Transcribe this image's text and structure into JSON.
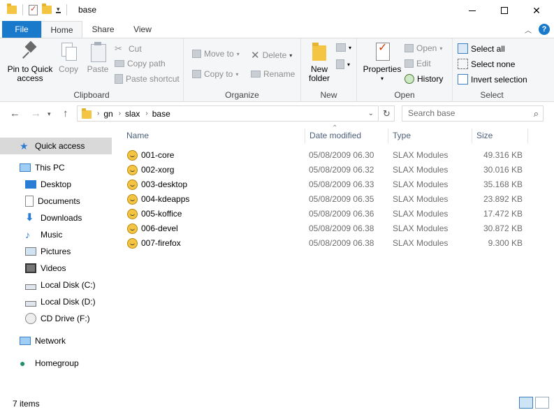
{
  "window": {
    "title": "base",
    "qat_dropdown": "▾"
  },
  "tabs": {
    "file": "File",
    "home": "Home",
    "share": "Share",
    "view": "View"
  },
  "ribbon": {
    "clipboard": {
      "label": "Clipboard",
      "pin_line1": "Pin to Quick",
      "pin_line2": "access",
      "copy": "Copy",
      "paste": "Paste",
      "cut": "Cut",
      "copy_path": "Copy path",
      "paste_shortcut": "Paste shortcut"
    },
    "organize": {
      "label": "Organize",
      "move_to": "Move to",
      "copy_to": "Copy to",
      "delete": "Delete",
      "rename": "Rename"
    },
    "new": {
      "label": "New",
      "new_folder_line1": "New",
      "new_folder_line2": "folder"
    },
    "open": {
      "label": "Open",
      "properties": "Properties",
      "open": "Open",
      "edit": "Edit",
      "history": "History"
    },
    "select": {
      "label": "Select",
      "select_all": "Select all",
      "select_none": "Select none",
      "invert_selection": "Invert selection"
    }
  },
  "address": {
    "crumbs": [
      "gn",
      "slax",
      "base"
    ],
    "search_placeholder": "Search base"
  },
  "nav": {
    "quick_access": "Quick access",
    "this_pc": "This PC",
    "desktop": "Desktop",
    "documents": "Documents",
    "downloads": "Downloads",
    "music": "Music",
    "pictures": "Pictures",
    "videos": "Videos",
    "local_c": "Local Disk (C:)",
    "local_d": "Local Disk (D:)",
    "cd_drive": "CD Drive (F:)",
    "network": "Network",
    "homegroup": "Homegroup"
  },
  "columns": {
    "name": "Name",
    "date": "Date modified",
    "type": "Type",
    "size": "Size"
  },
  "files": [
    {
      "name": "001-core",
      "date": "05/08/2009 06.30",
      "type": "SLAX Modules",
      "size": "49.316 KB"
    },
    {
      "name": "002-xorg",
      "date": "05/08/2009 06.32",
      "type": "SLAX Modules",
      "size": "30.016 KB"
    },
    {
      "name": "003-desktop",
      "date": "05/08/2009 06.33",
      "type": "SLAX Modules",
      "size": "35.168 KB"
    },
    {
      "name": "004-kdeapps",
      "date": "05/08/2009 06.35",
      "type": "SLAX Modules",
      "size": "23.892 KB"
    },
    {
      "name": "005-koffice",
      "date": "05/08/2009 06.36",
      "type": "SLAX Modules",
      "size": "17.472 KB"
    },
    {
      "name": "006-devel",
      "date": "05/08/2009 06.38",
      "type": "SLAX Modules",
      "size": "30.872 KB"
    },
    {
      "name": "007-firefox",
      "date": "05/08/2009 06.38",
      "type": "SLAX Modules",
      "size": "9.300 KB"
    }
  ],
  "status": {
    "count": "7 items"
  },
  "colors": {
    "file_tab": "#1979ca",
    "folder": "#f4c542",
    "selection": "#d9d9d9"
  }
}
